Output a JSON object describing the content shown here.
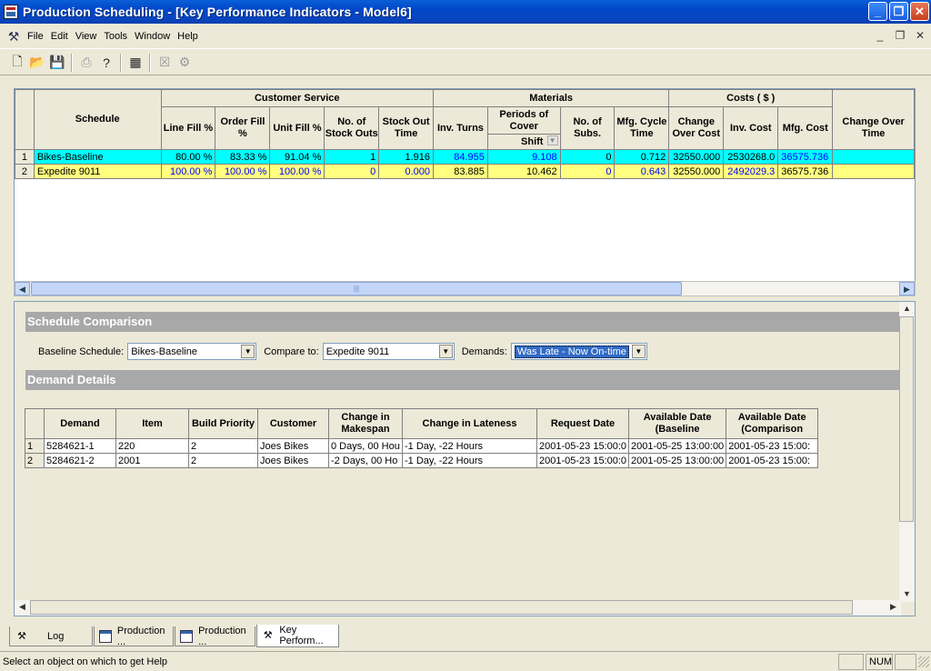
{
  "window": {
    "title": "Production Scheduling - [Key Performance Indicators - Model6]",
    "min_glyph": "_",
    "max_glyph": "❐",
    "close_glyph": "✕"
  },
  "menu": {
    "items": [
      "File",
      "Edit",
      "View",
      "Tools",
      "Window",
      "Help"
    ],
    "mdi_min": "_",
    "mdi_restore": "❐",
    "mdi_close": "✕"
  },
  "toolbar": {
    "icons": [
      "new-document-icon",
      "open-folder-icon",
      "save-icon",
      "print-icon",
      "help-icon",
      "grid-icon",
      "delete-icon",
      "tools-icon"
    ]
  },
  "kpi": {
    "group_headers": {
      "customer_service": "Customer Service",
      "materials": "Materials",
      "costs": "Costs ( $ )"
    },
    "columns": {
      "schedule": "Schedule",
      "line_fill": "Line Fill %",
      "order_fill": "Order Fill %",
      "unit_fill": "Unit Fill %",
      "stock_outs": "No. of Stock Outs",
      "stock_out_time": "Stock Out Time",
      "inv_turns": "Inv. Turns",
      "periods_cover": "Periods of Cover",
      "periods_cover_unit": "Shift",
      "subs": "No. of Subs.",
      "mfg_cycle": "Mfg. Cycle Time",
      "change_over_cost": "Change Over Cost",
      "inv_cost": "Inv. Cost",
      "mfg_cost": "Mfg. Cost",
      "change_over_time": "Change Over Time"
    },
    "rows": [
      {
        "idx": "1",
        "schedule": "Bikes-Baseline",
        "line_fill": "80.00 %",
        "order_fill": "83.33 %",
        "unit_fill": "91.04 %",
        "stock_outs": "1",
        "stock_out_time": "1.916",
        "inv_turns": "84.955",
        "periods_cover": "9.108",
        "subs": "0",
        "mfg_cycle": "0.712",
        "change_over_cost": "32550.000",
        "inv_cost": "2530268.0",
        "mfg_cost": "36575.736",
        "change_over_time": ""
      },
      {
        "idx": "2",
        "schedule": "Expedite 9011",
        "line_fill": "100.00 %",
        "order_fill": "100.00 %",
        "unit_fill": "100.00 %",
        "stock_outs": "0",
        "stock_out_time": "0.000",
        "inv_turns": "83.885",
        "periods_cover": "10.462",
        "subs": "0",
        "mfg_cycle": "0.643",
        "change_over_cost": "32550.000",
        "inv_cost": "2492029.3",
        "mfg_cost": "36575.736",
        "change_over_time": ""
      }
    ],
    "row_colors": [
      "#00ffff",
      "#ffff80"
    ]
  },
  "comparison": {
    "title": "Schedule Comparison",
    "baseline_label": "Baseline Schedule:",
    "baseline_value": "Bikes-Baseline",
    "compare_label": "Compare to:",
    "compare_value": "Expedite 9011",
    "demands_label": "Demands:",
    "demands_value": "Was Late - Now On-time"
  },
  "demand_details": {
    "title": "Demand Details",
    "columns": [
      "Demand",
      "Item",
      "Build Priority",
      "Customer",
      "Change in Makespan",
      "Change in Lateness",
      "Request Date",
      "Available Date (Baseline",
      "Available Date (Comparison"
    ],
    "rows": [
      {
        "idx": "1",
        "cells": [
          "5284621-1",
          "220",
          "2",
          "Joes Bikes",
          "0 Days, 00 Hou",
          "-1 Day, -22 Hours",
          "2001-05-23 15:00:0",
          "2001-05-25 13:00:00",
          "2001-05-23 15:00:"
        ]
      },
      {
        "idx": "2",
        "cells": [
          "5284621-2",
          "2001",
          "2",
          "Joes Bikes",
          "-2 Days, 00 Ho",
          "-1 Day, -22 Hours",
          "2001-05-23 15:00:0",
          "2001-05-25 13:00:00",
          "2001-05-23 15:00:"
        ]
      }
    ]
  },
  "tabs": [
    {
      "label": "Log",
      "icon": "log-icon"
    },
    {
      "label": "Production ...",
      "icon": "window-icon"
    },
    {
      "label": "Production ...",
      "icon": "window-icon"
    },
    {
      "label": "Key Perform...",
      "icon": "kpi-icon"
    }
  ],
  "status": {
    "message": "Select an object on which to get Help",
    "num": "NUM"
  }
}
